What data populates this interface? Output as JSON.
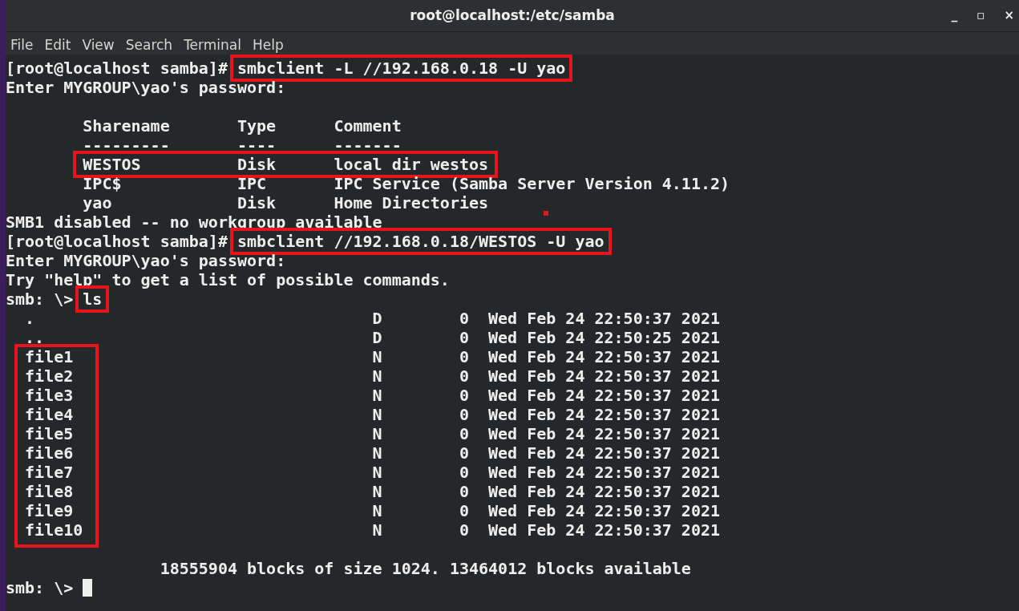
{
  "window": {
    "title": "root@localhost:/etc/samba",
    "controls": [
      "_",
      "▫",
      "×"
    ]
  },
  "menu": [
    "File",
    "Edit",
    "View",
    "Search",
    "Terminal",
    "Help"
  ],
  "terminal": [
    {
      "kind": "line",
      "segments": [
        {
          "text": "[root@localhost samba]# ",
          "highlighted": false
        },
        {
          "text": "smbclient -L //192.168.0.18 -U yao",
          "highlighted": true
        }
      ]
    },
    {
      "kind": "line",
      "segments": [
        {
          "text": "Enter MYGROUP\\yao's password:",
          "highlighted": false
        }
      ]
    },
    {
      "kind": "blank"
    },
    {
      "kind": "shares",
      "columns": [
        "Sharename",
        "Type",
        "Comment"
      ],
      "separators": [
        "---------",
        "----",
        "-------"
      ],
      "rows": [
        {
          "cells": [
            "WESTOS",
            "Disk",
            "local dir westos"
          ],
          "highlighted": true
        },
        {
          "cells": [
            "IPC$",
            "IPC",
            "IPC Service (Samba Server Version 4.11.2)"
          ],
          "highlighted": false
        },
        {
          "cells": [
            "yao",
            "Disk",
            "Home Directories"
          ],
          "highlighted": false
        }
      ]
    },
    {
      "kind": "line",
      "segments": [
        {
          "text": "SMB1 disabled -- no workgroup available",
          "highlighted": false
        }
      ]
    },
    {
      "kind": "line",
      "segments": [
        {
          "text": "[root@localhost samba]# ",
          "highlighted": false
        },
        {
          "text": "smbclient //192.168.0.18/WESTOS -U yao",
          "highlighted": true
        }
      ]
    },
    {
      "kind": "line",
      "segments": [
        {
          "text": "Enter MYGROUP\\yao's password:",
          "highlighted": false
        }
      ]
    },
    {
      "kind": "line",
      "segments": [
        {
          "text": "Try \"help\" to get a list of possible commands.",
          "highlighted": false
        }
      ]
    },
    {
      "kind": "line",
      "segments": [
        {
          "text": "smb: \\> ",
          "highlighted": false
        },
        {
          "text": "ls",
          "highlighted": true
        }
      ]
    },
    {
      "kind": "listing",
      "groups": [
        {
          "highlighted": false,
          "rows": [
            {
              "name": ".",
              "attr": "D",
              "size": "0",
              "date": "Wed Feb 24 22:50:37 2021"
            },
            {
              "name": "..",
              "attr": "D",
              "size": "0",
              "date": "Wed Feb 24 22:50:25 2021"
            }
          ]
        },
        {
          "highlighted": true,
          "rows": [
            {
              "name": "file1",
              "attr": "N",
              "size": "0",
              "date": "Wed Feb 24 22:50:37 2021"
            },
            {
              "name": "file2",
              "attr": "N",
              "size": "0",
              "date": "Wed Feb 24 22:50:37 2021"
            },
            {
              "name": "file3",
              "attr": "N",
              "size": "0",
              "date": "Wed Feb 24 22:50:37 2021"
            },
            {
              "name": "file4",
              "attr": "N",
              "size": "0",
              "date": "Wed Feb 24 22:50:37 2021"
            },
            {
              "name": "file5",
              "attr": "N",
              "size": "0",
              "date": "Wed Feb 24 22:50:37 2021"
            },
            {
              "name": "file6",
              "attr": "N",
              "size": "0",
              "date": "Wed Feb 24 22:50:37 2021"
            },
            {
              "name": "file7",
              "attr": "N",
              "size": "0",
              "date": "Wed Feb 24 22:50:37 2021"
            },
            {
              "name": "file8",
              "attr": "N",
              "size": "0",
              "date": "Wed Feb 24 22:50:37 2021"
            },
            {
              "name": "file9",
              "attr": "N",
              "size": "0",
              "date": "Wed Feb 24 22:50:37 2021"
            },
            {
              "name": "file10",
              "attr": "N",
              "size": "0",
              "date": "Wed Feb 24 22:50:37 2021"
            }
          ]
        }
      ]
    },
    {
      "kind": "blank"
    },
    {
      "kind": "summary",
      "text": "18555904 blocks of size 1024. 13464012 blocks available"
    },
    {
      "kind": "prompt",
      "text": "smb: \\> ",
      "cursor": true
    }
  ]
}
